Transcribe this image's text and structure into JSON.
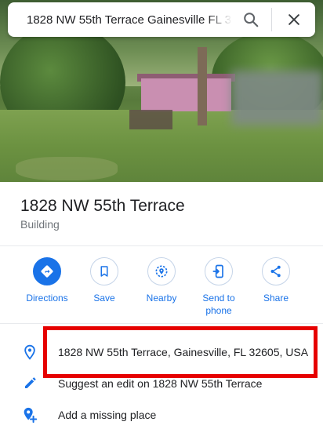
{
  "search": {
    "query": "1828 NW 55th Terrace  Gainesville FL 3",
    "search_icon": "search-icon",
    "close_icon": "close-icon"
  },
  "photo": {
    "description_icon": "street-view-photo"
  },
  "place": {
    "title": "1828 NW 55th Terrace",
    "category": "Building"
  },
  "actions": [
    {
      "label": "Directions",
      "icon": "directions-icon"
    },
    {
      "label": "Save",
      "icon": "bookmark-icon"
    },
    {
      "label": "Nearby",
      "icon": "nearby-icon"
    },
    {
      "label": "Send to phone",
      "icon": "send-to-phone-icon"
    },
    {
      "label": "Share",
      "icon": "share-icon"
    }
  ],
  "info": {
    "address": "1828 NW 55th Terrace, Gainesville, FL 32605, USA",
    "suggest_edit": "Suggest an edit on 1828 NW 55th Terrace",
    "add_place": "Add a missing place"
  },
  "colors": {
    "accent": "#1a73e8",
    "highlight": "#e60000",
    "text": "#202124",
    "muted": "#70757a"
  }
}
